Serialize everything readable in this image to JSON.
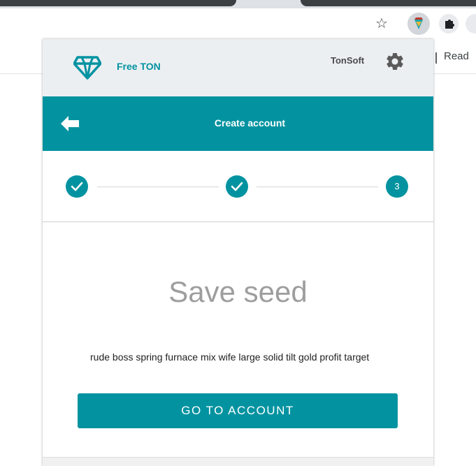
{
  "browser": {
    "reading_list_label": "Read",
    "icons": {
      "bookmark": "star-icon",
      "extension": "free-ton-extension-icon",
      "extensions_menu": "puzzle-icon",
      "profile": "profile-icon"
    },
    "star_glyph": "☆"
  },
  "header": {
    "brand": "Free TON",
    "network": "TonSoft",
    "icons": {
      "logo": "diamond-logo-icon",
      "settings": "gear-icon"
    }
  },
  "appbar": {
    "title": "Create account",
    "back_icon": "arrow-left-icon"
  },
  "stepper": {
    "steps": [
      {
        "state": "completed",
        "label": ""
      },
      {
        "state": "completed",
        "label": ""
      },
      {
        "state": "active",
        "label": "3"
      }
    ]
  },
  "content": {
    "title": "Save seed",
    "seed_phrase": "rude boss spring furnace mix wife large solid tilt gold profit target",
    "button_label": "GO TO ACCOUNT"
  },
  "colors": {
    "accent": "#0393a0",
    "header_bg": "#eceff2",
    "title_gray": "#9e9e9e"
  }
}
